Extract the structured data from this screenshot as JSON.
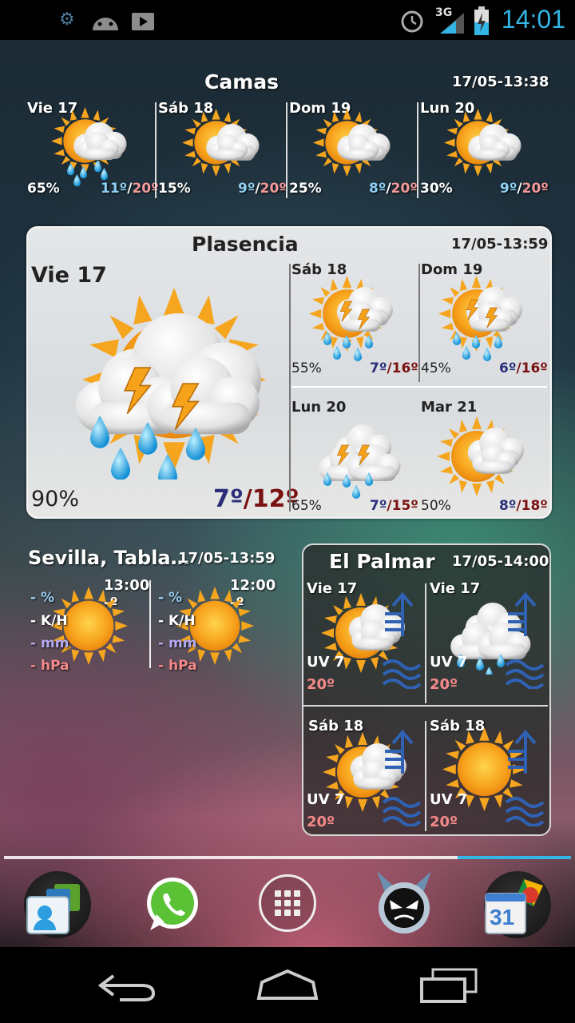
{
  "status_bar": {
    "time": "14:01",
    "network": "3G"
  },
  "camas": {
    "title": "Camas",
    "updated": "17/05-13:38",
    "days": [
      {
        "day": "Vie 17",
        "rain": "65%",
        "min": "11º",
        "max": "20º",
        "icon": "sun-cloud-rain-icon"
      },
      {
        "day": "Sáb 18",
        "rain": "15%",
        "min": "9º",
        "max": "20º",
        "icon": "sun-cloud-icon"
      },
      {
        "day": "Dom 19",
        "rain": "25%",
        "min": "8º",
        "max": "20º",
        "icon": "sun-cloud-icon"
      },
      {
        "day": "Lun 20",
        "rain": "30%",
        "min": "9º",
        "max": "20º",
        "icon": "sun-cloud-icon"
      }
    ]
  },
  "plasencia": {
    "title": "Plasencia",
    "updated": "17/05-13:59",
    "today": {
      "day": "Vie 17",
      "rain": "90%",
      "min": "7º",
      "max": "12º",
      "icon": "storm-rain-icon"
    },
    "days": [
      {
        "day": "Sáb 18",
        "rain": "55%",
        "min": "7º",
        "max": "16º",
        "icon": "sun-storm-rain-icon"
      },
      {
        "day": "Dom 19",
        "rain": "45%",
        "min": "6º",
        "max": "16º",
        "icon": "sun-storm-rain-icon"
      },
      {
        "day": "Lun 20",
        "rain": "65%",
        "min": "7º",
        "max": "15º",
        "icon": "storm-rain-icon"
      },
      {
        "day": "Mar 21",
        "rain": "50%",
        "min": "8º",
        "max": "18º",
        "icon": "sun-cloud-icon"
      }
    ]
  },
  "sevilla": {
    "title": "Sevilla, Tabla…",
    "updated": "17/05-13:59",
    "columns": [
      {
        "time": "13:00",
        "temp": "-º",
        "rows": [
          "- %",
          "- K/H",
          "- mm",
          "- hPa"
        ]
      },
      {
        "time": "12:00",
        "temp": "-º",
        "rows": [
          "- %",
          "- K/H",
          "- mm",
          "- hPa"
        ]
      }
    ]
  },
  "palmar": {
    "title": "El Palmar",
    "updated": "17/05-14:00",
    "cells": [
      {
        "day": "Vie 17",
        "uv": "UV 7",
        "temp": "20º",
        "icon": "sun-cloud-icon"
      },
      {
        "day": "Vie 17",
        "uv": "UV 7",
        "temp": "20º",
        "icon": "cloud-rain-icon"
      },
      {
        "day": "Sáb 18",
        "uv": "UV 7",
        "temp": "20º",
        "icon": "sun-cloud-icon"
      },
      {
        "day": "Sáb 18",
        "uv": "UV 7",
        "temp": "20º",
        "icon": "sun-icon"
      }
    ]
  },
  "dock": {
    "apps": [
      "contacts-icon",
      "whatsapp-icon",
      "app-drawer-icon",
      "angry-face-app-icon",
      "calendar-icon"
    ],
    "calendar_day": "31"
  },
  "nav": {
    "buttons": [
      "back-button",
      "home-button",
      "recents-button"
    ]
  }
}
